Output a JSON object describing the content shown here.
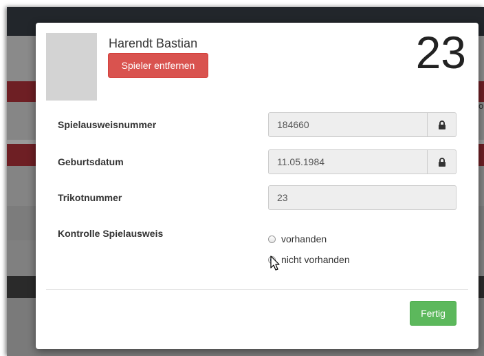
{
  "backdrop": {
    "edge_text": "o"
  },
  "modal": {
    "player_name": "Harendt Bastian",
    "remove_button_label": "Spieler entfernen",
    "jersey_number": "23",
    "fields": {
      "pass_number": {
        "label": "Spielausweisnummer",
        "value": "184660",
        "locked": true
      },
      "birth_date": {
        "label": "Geburtsdatum",
        "value": "11.05.1984",
        "locked": true
      },
      "jersey": {
        "label": "Trikotnummer",
        "value": "23"
      }
    },
    "pass_check": {
      "label": "Kontrolle Spielausweis",
      "options": [
        {
          "label": "vorhanden",
          "checked": false
        },
        {
          "label": "nicht vorhanden",
          "checked": true
        }
      ]
    },
    "done_button_label": "Fertig"
  },
  "icons": {
    "lock": "lock-icon",
    "cursor": "mouse-pointer-icon"
  },
  "colors": {
    "danger": "#d9534f",
    "success": "#5cb85c",
    "backdrop_red": "#6e1f24"
  }
}
